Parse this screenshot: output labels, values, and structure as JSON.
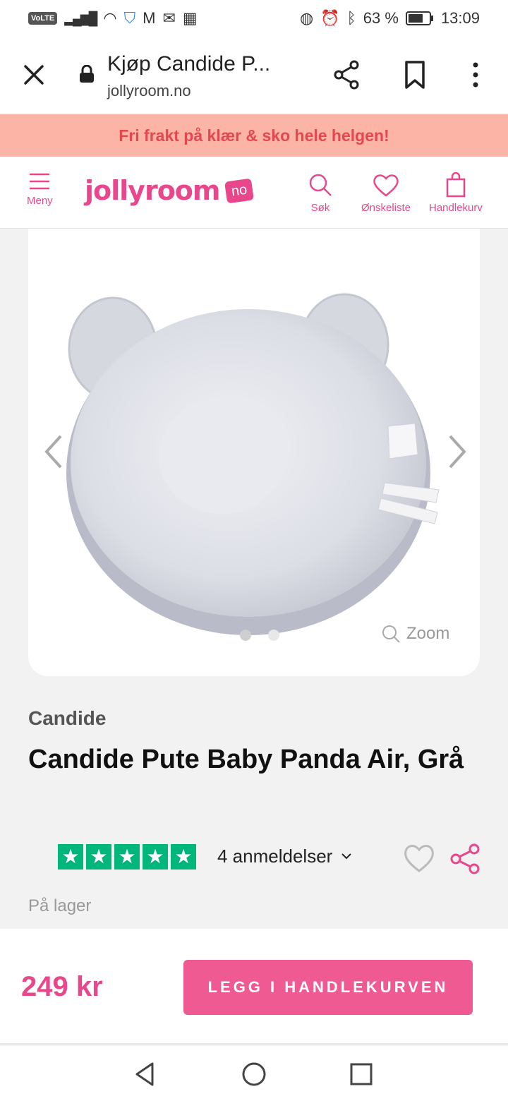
{
  "status_bar": {
    "volte": "VoLTE",
    "battery": "63 %",
    "time": "13:09"
  },
  "browser": {
    "title": "Kjøp Candide P...",
    "domain": "jollyroom.no"
  },
  "promo": {
    "text": "Fri frakt på klær & sko hele helgen!"
  },
  "header": {
    "logo": "jollyroom",
    "logo_badge": "no",
    "menu_label": "Meny",
    "search_label": "Søk",
    "wishlist_label": "Ønskeliste",
    "cart_label": "Handlekurv"
  },
  "gallery": {
    "zoom_label": "Zoom",
    "image_count": 2,
    "active_index": 0
  },
  "product": {
    "brand": "Candide",
    "title": "Candide Pute Baby Panda Air, Grå",
    "rating_stars": 5,
    "reviews_label": "4 anmeldelser",
    "stock": "På lager",
    "price": "249 kr",
    "add_to_cart_label": "LEGG I HANDLEKURVEN"
  },
  "colors": {
    "brand_pink": "#e8488b",
    "promo_bg": "#fbb4a6",
    "trustpilot_green": "#00b67a"
  }
}
